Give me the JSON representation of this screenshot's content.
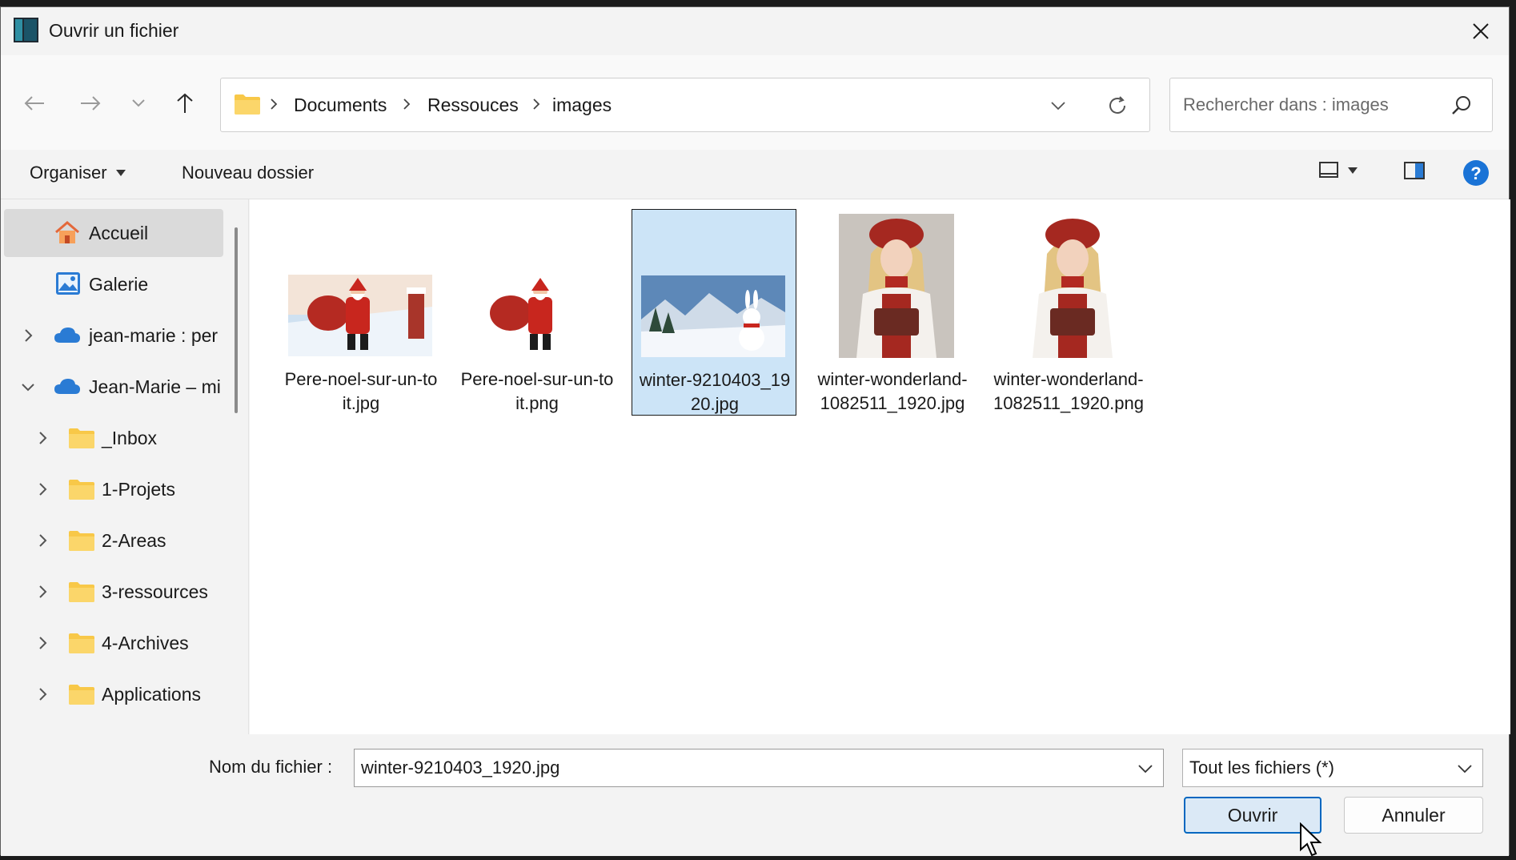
{
  "window": {
    "title": "Ouvrir un fichier"
  },
  "address": {
    "crumbs": [
      "Documents",
      "Ressouces",
      "images"
    ]
  },
  "search": {
    "placeholder": "Rechercher dans : images"
  },
  "toolbar": {
    "organize_label": "Organiser",
    "new_folder_label": "Nouveau dossier"
  },
  "sidebar": {
    "items": [
      {
        "label": "Accueil",
        "icon": "home-icon",
        "active": true
      },
      {
        "label": "Galerie",
        "icon": "gallery-icon"
      },
      {
        "label": "jean-marie : per",
        "icon": "cloud-icon",
        "expand": "collapsed"
      },
      {
        "label": "Jean-Marie – mi",
        "icon": "cloud-icon",
        "expand": "expanded"
      },
      {
        "label": "_Inbox",
        "icon": "folder-icon",
        "expand": "collapsed"
      },
      {
        "label": "1-Projets",
        "icon": "folder-icon",
        "expand": "collapsed"
      },
      {
        "label": "2-Areas",
        "icon": "folder-icon",
        "expand": "collapsed"
      },
      {
        "label": "3-ressources",
        "icon": "folder-icon",
        "expand": "collapsed"
      },
      {
        "label": "4-Archives",
        "icon": "folder-icon",
        "expand": "collapsed"
      },
      {
        "label": "Applications",
        "icon": "folder-icon",
        "expand": "collapsed"
      }
    ]
  },
  "files": [
    {
      "name": "Pere-noel-sur-un-toit.jpg",
      "thumbnail": "santa-roof-image"
    },
    {
      "name": "Pere-noel-sur-un-toit.png",
      "thumbnail": "santa-image"
    },
    {
      "name": "winter-9210403_1920.jpg",
      "thumbnail": "snowman-image",
      "selected": true
    },
    {
      "name": "winter-wonderland-1082511_1920.jpg",
      "thumbnail": "girl-winter-image"
    },
    {
      "name": "winter-wonderland-1082511_1920.png",
      "thumbnail": "girl-image"
    }
  ],
  "bottom": {
    "filename_label": "Nom du fichier :",
    "filename_value": "winter-9210403_1920.jpg",
    "filetype_value": "Tout les fichiers (*)",
    "open_label": "Ouvrir",
    "cancel_label": "Annuler"
  },
  "colors": {
    "accent": "#0067c0",
    "selection": "#cce4f7",
    "folder": "#f8c848",
    "cloud": "#2a7bd4"
  }
}
